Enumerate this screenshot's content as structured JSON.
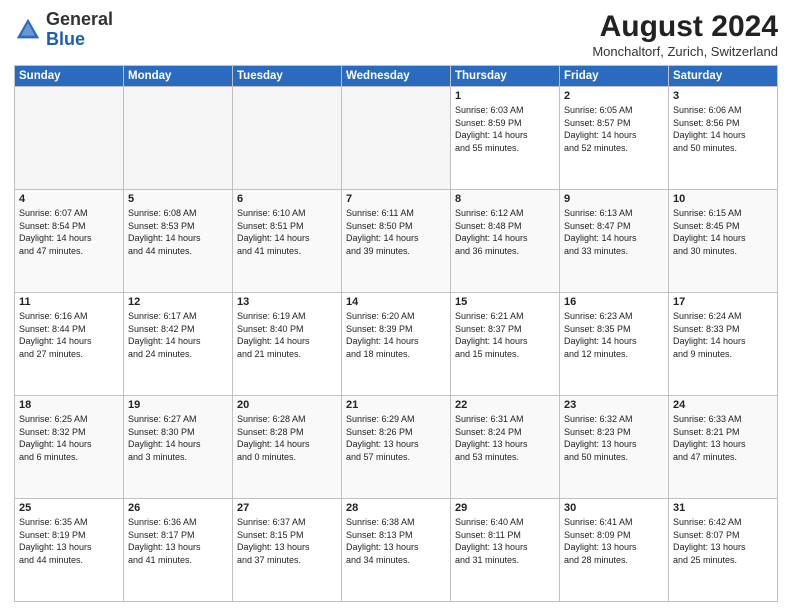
{
  "header": {
    "logo_general": "General",
    "logo_blue": "Blue",
    "title": "August 2024",
    "location": "Monchaltorf, Zurich, Switzerland"
  },
  "weekdays": [
    "Sunday",
    "Monday",
    "Tuesday",
    "Wednesday",
    "Thursday",
    "Friday",
    "Saturday"
  ],
  "weeks": [
    [
      {
        "num": "",
        "info": ""
      },
      {
        "num": "",
        "info": ""
      },
      {
        "num": "",
        "info": ""
      },
      {
        "num": "",
        "info": ""
      },
      {
        "num": "1",
        "info": "Sunrise: 6:03 AM\nSunset: 8:59 PM\nDaylight: 14 hours\nand 55 minutes."
      },
      {
        "num": "2",
        "info": "Sunrise: 6:05 AM\nSunset: 8:57 PM\nDaylight: 14 hours\nand 52 minutes."
      },
      {
        "num": "3",
        "info": "Sunrise: 6:06 AM\nSunset: 8:56 PM\nDaylight: 14 hours\nand 50 minutes."
      }
    ],
    [
      {
        "num": "4",
        "info": "Sunrise: 6:07 AM\nSunset: 8:54 PM\nDaylight: 14 hours\nand 47 minutes."
      },
      {
        "num": "5",
        "info": "Sunrise: 6:08 AM\nSunset: 8:53 PM\nDaylight: 14 hours\nand 44 minutes."
      },
      {
        "num": "6",
        "info": "Sunrise: 6:10 AM\nSunset: 8:51 PM\nDaylight: 14 hours\nand 41 minutes."
      },
      {
        "num": "7",
        "info": "Sunrise: 6:11 AM\nSunset: 8:50 PM\nDaylight: 14 hours\nand 39 minutes."
      },
      {
        "num": "8",
        "info": "Sunrise: 6:12 AM\nSunset: 8:48 PM\nDaylight: 14 hours\nand 36 minutes."
      },
      {
        "num": "9",
        "info": "Sunrise: 6:13 AM\nSunset: 8:47 PM\nDaylight: 14 hours\nand 33 minutes."
      },
      {
        "num": "10",
        "info": "Sunrise: 6:15 AM\nSunset: 8:45 PM\nDaylight: 14 hours\nand 30 minutes."
      }
    ],
    [
      {
        "num": "11",
        "info": "Sunrise: 6:16 AM\nSunset: 8:44 PM\nDaylight: 14 hours\nand 27 minutes."
      },
      {
        "num": "12",
        "info": "Sunrise: 6:17 AM\nSunset: 8:42 PM\nDaylight: 14 hours\nand 24 minutes."
      },
      {
        "num": "13",
        "info": "Sunrise: 6:19 AM\nSunset: 8:40 PM\nDaylight: 14 hours\nand 21 minutes."
      },
      {
        "num": "14",
        "info": "Sunrise: 6:20 AM\nSunset: 8:39 PM\nDaylight: 14 hours\nand 18 minutes."
      },
      {
        "num": "15",
        "info": "Sunrise: 6:21 AM\nSunset: 8:37 PM\nDaylight: 14 hours\nand 15 minutes."
      },
      {
        "num": "16",
        "info": "Sunrise: 6:23 AM\nSunset: 8:35 PM\nDaylight: 14 hours\nand 12 minutes."
      },
      {
        "num": "17",
        "info": "Sunrise: 6:24 AM\nSunset: 8:33 PM\nDaylight: 14 hours\nand 9 minutes."
      }
    ],
    [
      {
        "num": "18",
        "info": "Sunrise: 6:25 AM\nSunset: 8:32 PM\nDaylight: 14 hours\nand 6 minutes."
      },
      {
        "num": "19",
        "info": "Sunrise: 6:27 AM\nSunset: 8:30 PM\nDaylight: 14 hours\nand 3 minutes."
      },
      {
        "num": "20",
        "info": "Sunrise: 6:28 AM\nSunset: 8:28 PM\nDaylight: 14 hours\nand 0 minutes."
      },
      {
        "num": "21",
        "info": "Sunrise: 6:29 AM\nSunset: 8:26 PM\nDaylight: 13 hours\nand 57 minutes."
      },
      {
        "num": "22",
        "info": "Sunrise: 6:31 AM\nSunset: 8:24 PM\nDaylight: 13 hours\nand 53 minutes."
      },
      {
        "num": "23",
        "info": "Sunrise: 6:32 AM\nSunset: 8:23 PM\nDaylight: 13 hours\nand 50 minutes."
      },
      {
        "num": "24",
        "info": "Sunrise: 6:33 AM\nSunset: 8:21 PM\nDaylight: 13 hours\nand 47 minutes."
      }
    ],
    [
      {
        "num": "25",
        "info": "Sunrise: 6:35 AM\nSunset: 8:19 PM\nDaylight: 13 hours\nand 44 minutes."
      },
      {
        "num": "26",
        "info": "Sunrise: 6:36 AM\nSunset: 8:17 PM\nDaylight: 13 hours\nand 41 minutes."
      },
      {
        "num": "27",
        "info": "Sunrise: 6:37 AM\nSunset: 8:15 PM\nDaylight: 13 hours\nand 37 minutes."
      },
      {
        "num": "28",
        "info": "Sunrise: 6:38 AM\nSunset: 8:13 PM\nDaylight: 13 hours\nand 34 minutes."
      },
      {
        "num": "29",
        "info": "Sunrise: 6:40 AM\nSunset: 8:11 PM\nDaylight: 13 hours\nand 31 minutes."
      },
      {
        "num": "30",
        "info": "Sunrise: 6:41 AM\nSunset: 8:09 PM\nDaylight: 13 hours\nand 28 minutes."
      },
      {
        "num": "31",
        "info": "Sunrise: 6:42 AM\nSunset: 8:07 PM\nDaylight: 13 hours\nand 25 minutes."
      }
    ]
  ]
}
